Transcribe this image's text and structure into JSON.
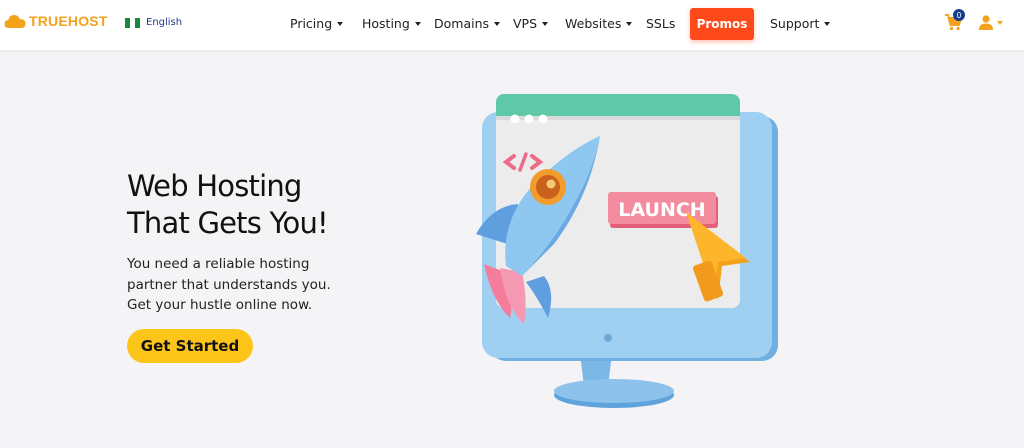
{
  "brand": {
    "name": "TRUEHOST"
  },
  "language": {
    "label": "English"
  },
  "nav": {
    "pricing": "Pricing",
    "hosting": "Hosting",
    "domains": "Domains",
    "vps": "VPS",
    "websites": "Websites",
    "ssls": "SSLs",
    "promos": "Promos",
    "support": "Support"
  },
  "cart": {
    "count": "0"
  },
  "hero": {
    "headline_line1": "Web Hosting",
    "headline_line2": "That Gets You!",
    "sub_line1": "You need a reliable hosting",
    "sub_line2": "partner that understands you.",
    "sub_line3": "Get your hustle online now.",
    "cta": "Get Started"
  },
  "illustration": {
    "sign_text": "LAUNCH"
  },
  "colors": {
    "brand_orange": "#f4a11b",
    "promo_red": "#fe4a1a",
    "cta_yellow": "#fdc51a",
    "badge_blue": "#173d8f",
    "page_bg": "#f4f4f6"
  },
  "icons": [
    "cloud-logo-icon",
    "nigeria-flag-icon",
    "cart-icon",
    "user-icon",
    "code-icon",
    "rocket-icon",
    "cursor-arrow-icon"
  ]
}
